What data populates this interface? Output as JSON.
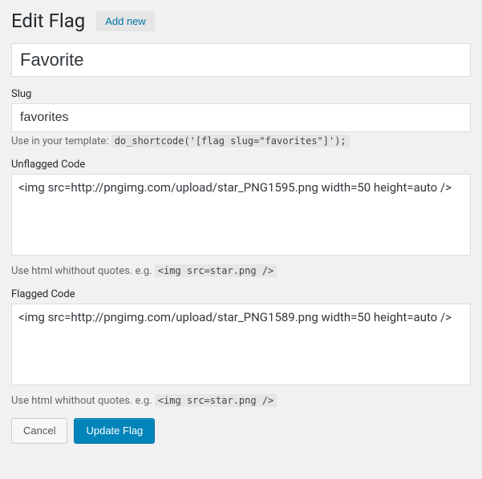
{
  "header": {
    "title": "Edit Flag",
    "add_new": "Add new"
  },
  "name": {
    "value": "Favorite"
  },
  "slug": {
    "label": "Slug",
    "value": "favorites",
    "hint_prefix": "Use in your template: ",
    "hint_code": "do_shortcode('[flag slug=\"favorites\"]');"
  },
  "unflagged": {
    "label": "Unflagged Code",
    "value": "<img src=http://pngimg.com/upload/star_PNG1595.png width=50 height=auto />",
    "hint_prefix": "Use html whithout quotes. e.g. ",
    "hint_code": "<img src=star.png />"
  },
  "flagged": {
    "label": "Flagged Code",
    "value": "<img src=http://pngimg.com/upload/star_PNG1589.png width=50 height=auto />",
    "hint_prefix": "Use html whithout quotes. e.g. ",
    "hint_code": "<img src=star.png />"
  },
  "buttons": {
    "cancel": "Cancel",
    "submit": "Update Flag"
  }
}
